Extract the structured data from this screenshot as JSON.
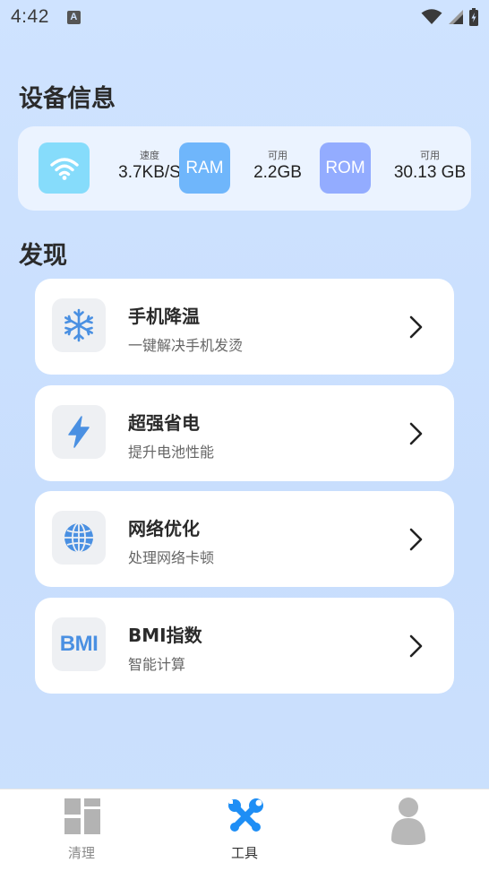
{
  "status_bar": {
    "time": "4:42",
    "app_badge": "A"
  },
  "device_section": {
    "title": "设备信息",
    "stats": [
      {
        "icon": "wifi-icon",
        "icon_label": "",
        "caption": "速度",
        "value": "3.7KB/S",
        "color": "#86dcfb"
      },
      {
        "icon": "ram-icon",
        "icon_label": "RAM",
        "caption": "可用",
        "value": "2.2GB",
        "color": "#6fb6fb"
      },
      {
        "icon": "rom-icon",
        "icon_label": "ROM",
        "caption": "可用",
        "value": "30.13 GB",
        "color": "#93acff"
      }
    ]
  },
  "discover_section": {
    "title": "发现",
    "items": [
      {
        "icon": "snowflake-icon",
        "title": "手机降温",
        "subtitle": "一键解决手机发烫"
      },
      {
        "icon": "lightning-icon",
        "title": "超强省电",
        "subtitle": "提升电池性能"
      },
      {
        "icon": "globe-icon",
        "title": "网络优化",
        "subtitle": "处理网络卡顿"
      },
      {
        "icon": "bmi-icon",
        "icon_label": "BMI",
        "title": "BMI指数",
        "subtitle": "智能计算"
      }
    ]
  },
  "bottom_nav": {
    "items": [
      {
        "icon": "grid-layout-icon",
        "label": "清理",
        "active": false
      },
      {
        "icon": "tools-icon",
        "label": "工具",
        "active": true
      },
      {
        "icon": "profile-icon",
        "label": "",
        "active": false
      }
    ]
  },
  "colors": {
    "accent_blue": "#1e8ef5",
    "icon_blue": "#4a90e2",
    "background": "#cfe3ff"
  }
}
